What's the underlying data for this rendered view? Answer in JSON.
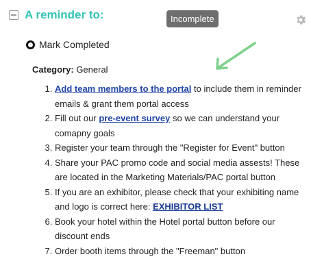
{
  "header": {
    "title": "A reminder to:",
    "status": "Incomplete"
  },
  "mark": {
    "label": "Mark Completed"
  },
  "category": {
    "key": "Category:",
    "value": "General"
  },
  "steps": [
    {
      "link": "Add team members to the portal",
      "text": " to include them in reminder emails & grant them portal access"
    },
    {
      "pre": "Fill out our ",
      "link": "pre-event survey",
      "text": " so we can understand your comapny goals"
    },
    {
      "text": "Register your team through the \"Register for Event\" button"
    },
    {
      "text": "Share your PAC promo code and social media assests! These are located in the Marketing Materials/PAC portal button"
    },
    {
      "pre": "If you are an exhibitor, please check that your exhibiting name and logo is correct here: ",
      "link": "EXHIBITOR LIST"
    },
    {
      "text": "Book your hotel within the Hotel portal button before our discount ends"
    },
    {
      "text": "Order booth items through the \"Freeman\" button"
    }
  ],
  "icons": {
    "collapse": "collapse-minus-icon",
    "settings": "gear-icon",
    "arrow": "annotation-arrow-icon"
  },
  "colors": {
    "title": "#32c3b5",
    "badge": "#6e6e6e",
    "link": "#1f43a8",
    "arrow": "#7ed18a"
  }
}
